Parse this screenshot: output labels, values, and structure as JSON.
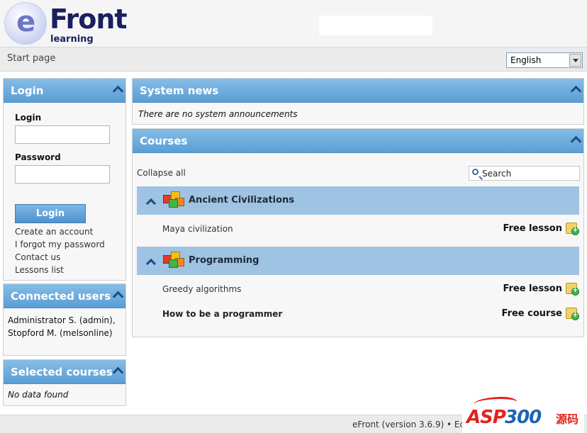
{
  "header": {
    "logo": {
      "letter": "e",
      "brand": "Front",
      "tagline": "learning"
    }
  },
  "nav": {
    "start_page": "Start page",
    "language": "English"
  },
  "login": {
    "title": "Login",
    "login_label": "Login",
    "password_label": "Password",
    "button": "Login",
    "links": [
      "Create an account",
      "I forgot my password",
      "Contact us",
      "Lessons list"
    ]
  },
  "connected_users": {
    "title": "Connected users",
    "text": "Administrator S. (admin), Stopford M. (melsonline)"
  },
  "selected_courses": {
    "title": "Selected courses",
    "empty": "No data found"
  },
  "system_news": {
    "title": "System news",
    "empty": "There are no system announcements"
  },
  "courses": {
    "title": "Courses",
    "collapse_all": "Collapse all",
    "search": "Search",
    "categories": [
      {
        "name": "Ancient Civilizations",
        "items": [
          {
            "name": "Maya civilization",
            "type": "Free lesson"
          }
        ]
      },
      {
        "name": "Programming",
        "items": [
          {
            "name": "Greedy algorithms",
            "type": "Free lesson"
          },
          {
            "name": "How to be a programmer",
            "type": "Free course"
          }
        ]
      }
    ]
  },
  "footer": {
    "text": "eFront (version 3.6.9) • Ed"
  },
  "watermark": {
    "part1": "ASP",
    "part2": "300",
    "part3": "源码"
  },
  "colors": {
    "header_blue": "#5a9ed5",
    "category_row": "#9fc3e2",
    "logo_navy": "#1a1f5e"
  }
}
